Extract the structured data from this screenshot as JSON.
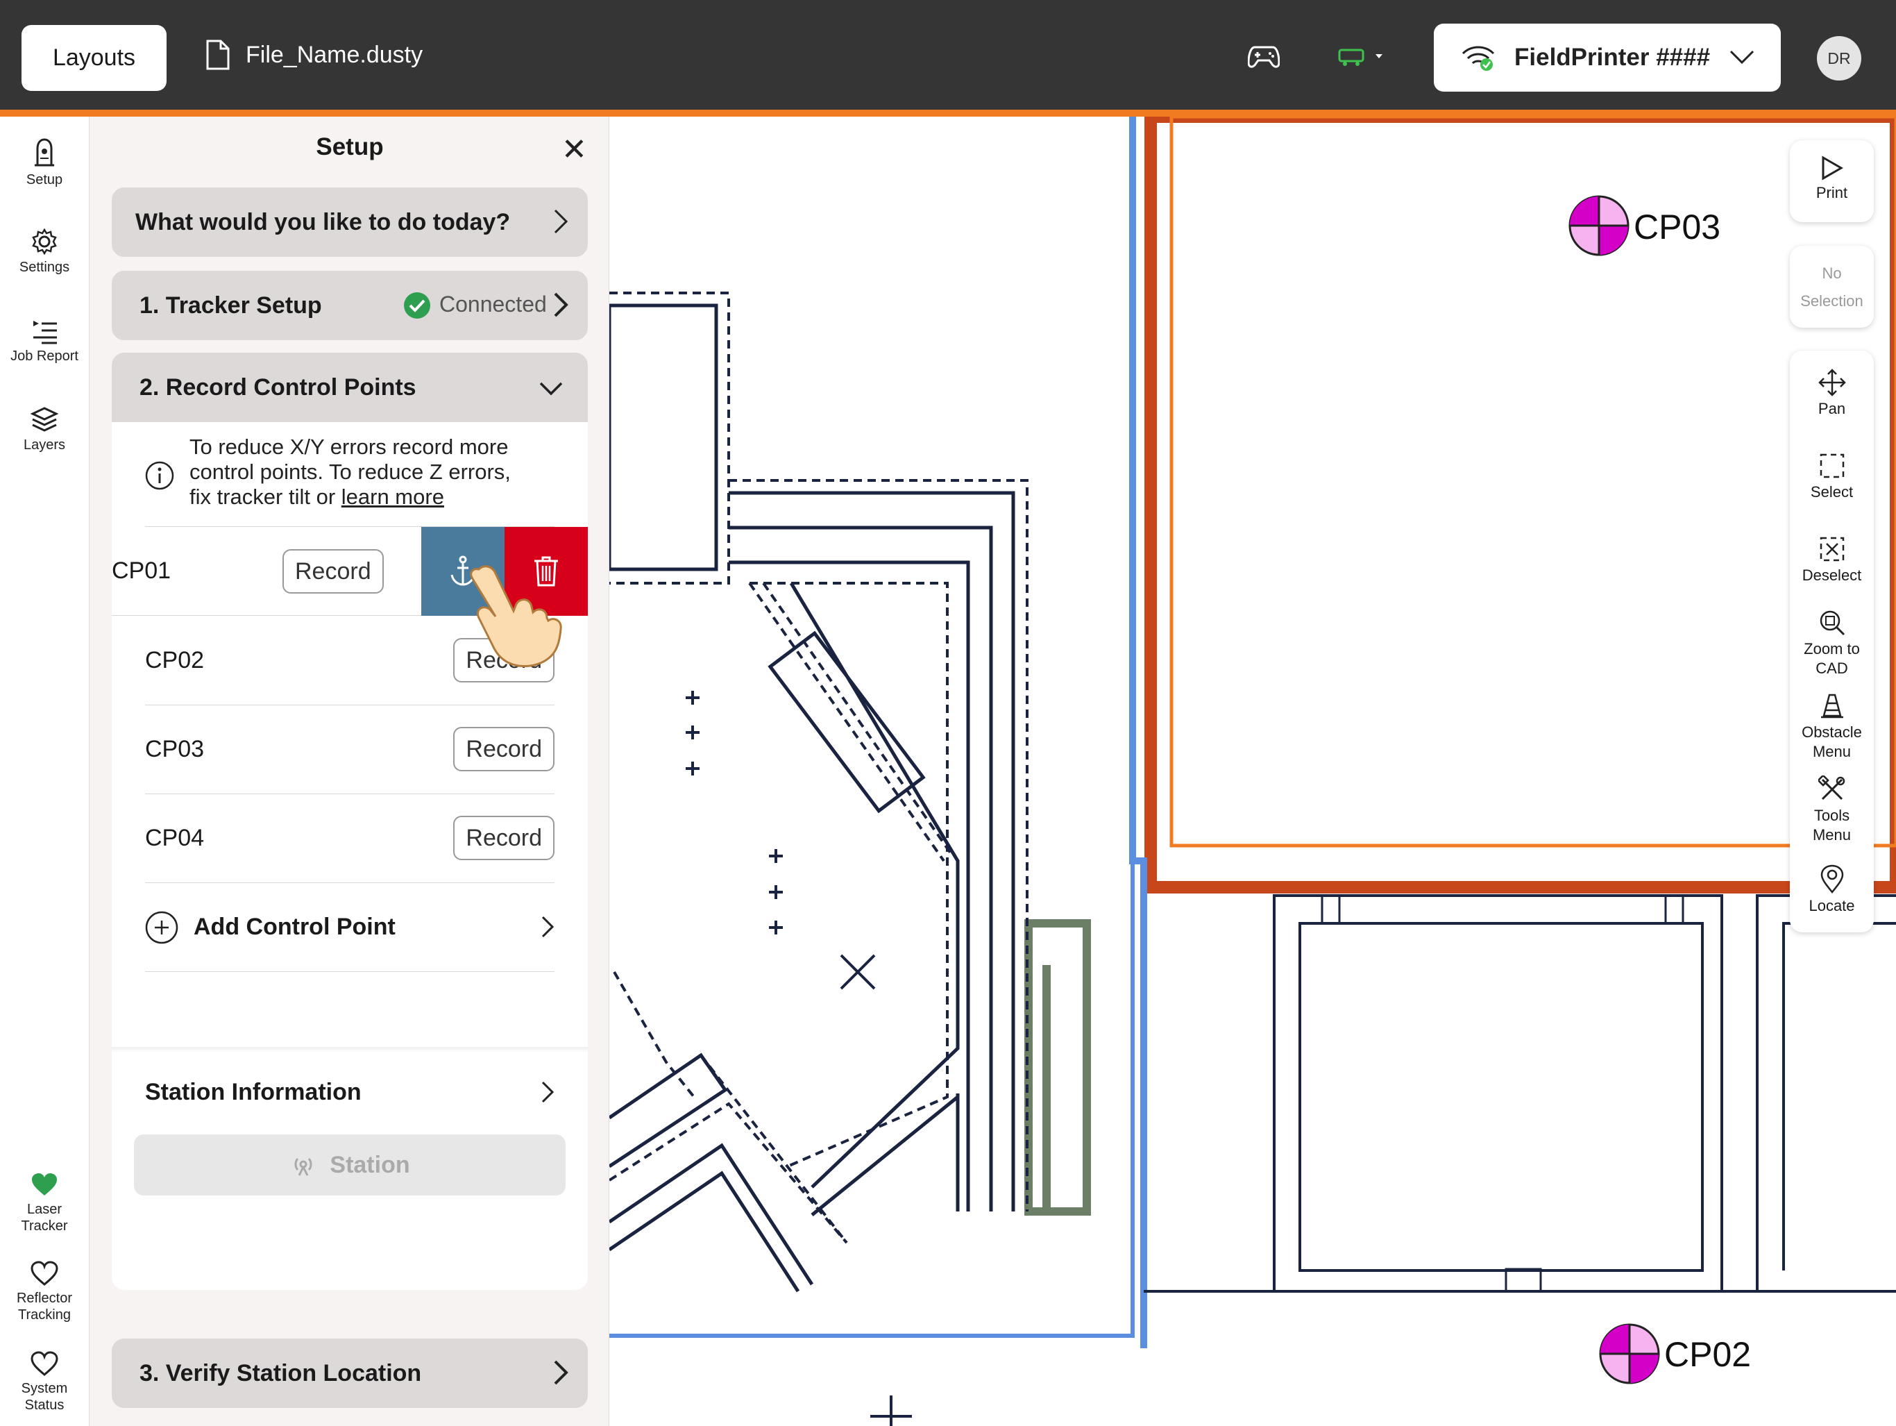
{
  "topbar": {
    "layouts_label": "Layouts",
    "file_name": "File_Name.dusty",
    "printer_name": "FieldPrinter ####",
    "avatar_initials": "DR"
  },
  "leftnav": {
    "items": [
      {
        "label": "Setup",
        "icon": "pin-device-icon"
      },
      {
        "label": "Settings",
        "icon": "gear-icon"
      },
      {
        "label": "Job Report",
        "icon": "list-icon"
      },
      {
        "label": "Layers",
        "icon": "layers-icon"
      }
    ],
    "status": [
      {
        "label": "Laser\nTracker",
        "icon": "heart-filled-icon",
        "color": "#2e9e4f"
      },
      {
        "label": "Reflector\nTracking",
        "icon": "heart-outline-icon"
      },
      {
        "label": "System\nStatus",
        "icon": "heart-outline-icon"
      }
    ]
  },
  "panel": {
    "title": "Setup",
    "question": "What would you like to do today?",
    "tracker_setup": "1. Tracker Setup",
    "tracker_status": "Connected",
    "record_cp": "2. Record Control Points",
    "info_line1": "To reduce X/Y errors record more",
    "info_line2": "control points. To reduce Z errors,",
    "info_line3": "fix tracker tilt or ",
    "info_link": "learn more",
    "control_points": [
      {
        "name": "CP01",
        "button": "Record"
      },
      {
        "name": "CP02",
        "button": "Record"
      },
      {
        "name": "CP03",
        "button": "Record"
      },
      {
        "name": "CP04",
        "button": "Record"
      }
    ],
    "add_cp": "Add Control Point",
    "station_info": "Station Information",
    "station_button": "Station",
    "verify": "3. Verify Station Location"
  },
  "canvas": {
    "markers": [
      {
        "label": "CP03"
      },
      {
        "label": "CP02"
      }
    ],
    "colors": {
      "marker": "#d400c8",
      "marker_light": "#f6b3f0",
      "orange": "#f07b21",
      "dark_orange": "#c8471a",
      "blue": "#5b8ee0",
      "green": "#6b7f66",
      "delete": "#d7001b",
      "anchor": "#4a7b9d"
    }
  },
  "toolbar": {
    "print": "Print",
    "no_selection_1": "No",
    "no_selection_2": "Selection",
    "pan": "Pan",
    "select": "Select",
    "deselect": "Deselect",
    "zoom_1": "Zoom to",
    "zoom_2": "CAD",
    "obstacle_1": "Obstacle",
    "obstacle_2": "Menu",
    "tools_1": "Tools",
    "tools_2": "Menu",
    "locate": "Locate"
  }
}
